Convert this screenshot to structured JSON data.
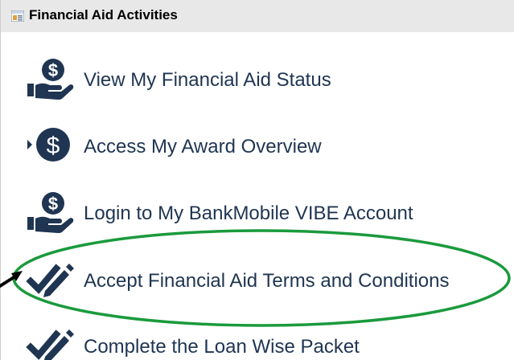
{
  "header": {
    "title": "Financial Aid Activities",
    "icon": "list-panel-icon"
  },
  "items": [
    {
      "label": "View My Financial Aid Status",
      "icon": "dollar-hand-icon"
    },
    {
      "label": "Access My Award Overview",
      "icon": "dollar-circle-icon"
    },
    {
      "label": "Login to My BankMobile VIBE Account",
      "icon": "dollar-hand-icon"
    },
    {
      "label": "Accept Financial Aid Terms and Conditions",
      "icon": "check-pen-icon"
    },
    {
      "label": "Complete the Loan Wise Packet",
      "icon": "check-pen-icon"
    }
  ],
  "colors": {
    "icon": "#1f3552",
    "text": "#1f3552",
    "highlight_ellipse": "#1a9a3c",
    "arrow": "#000000"
  }
}
